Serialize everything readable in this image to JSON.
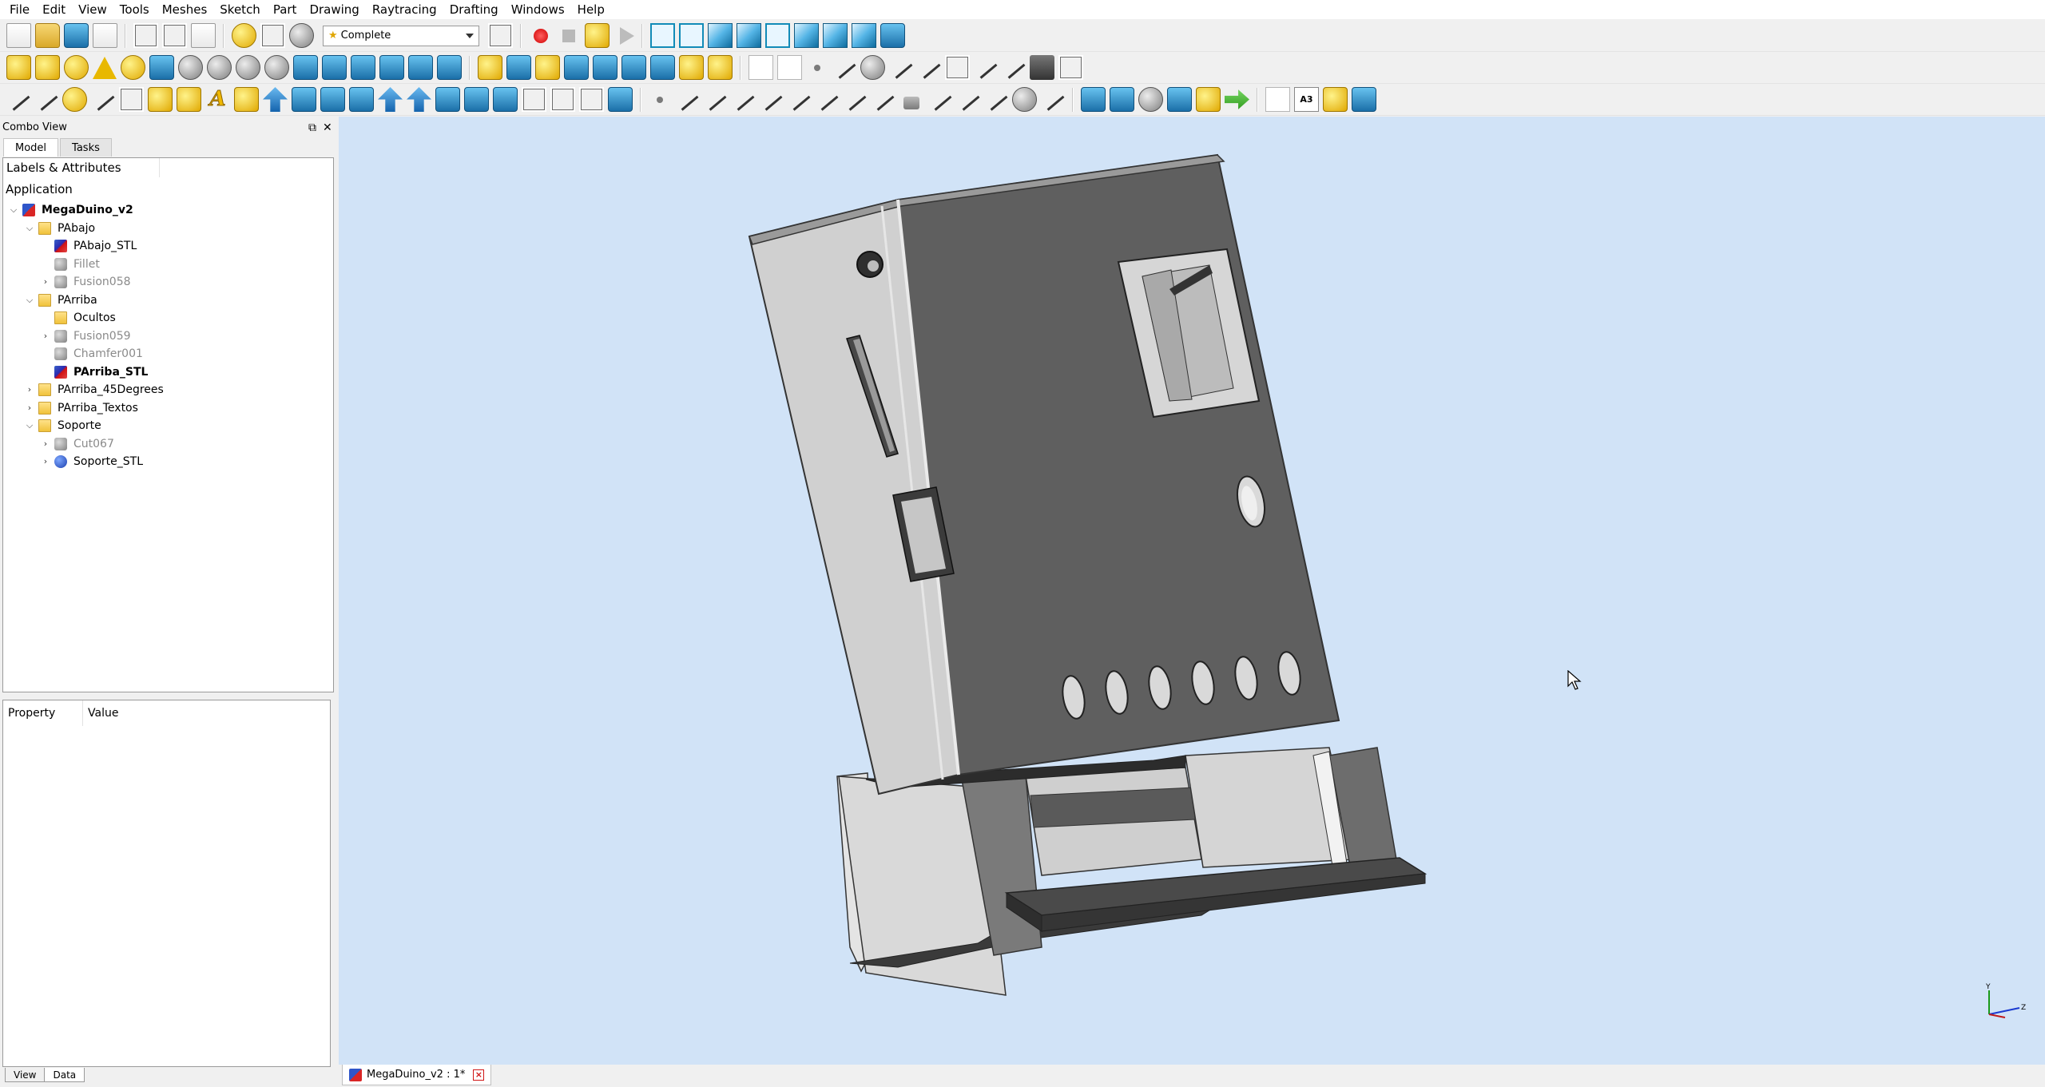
{
  "menu": [
    "File",
    "Edit",
    "View",
    "Tools",
    "Meshes",
    "Sketch",
    "Part",
    "Drawing",
    "Raytracing",
    "Drafting",
    "Windows",
    "Help"
  ],
  "workbench": {
    "selected": "Complete"
  },
  "combo_view": {
    "title": "Combo View",
    "tabs": [
      "Model",
      "Tasks"
    ],
    "tree_header": "Labels & Attributes",
    "application_label": "Application",
    "tree": [
      {
        "label": "MegaDuino_v2",
        "depth": 0,
        "expanded": true,
        "icon": "document-icon",
        "style": "bold"
      },
      {
        "label": "PAbajo",
        "depth": 1,
        "expanded": true,
        "icon": "folder-icon",
        "style": "normal"
      },
      {
        "label": "PAbajo_STL",
        "depth": 2,
        "expanded": null,
        "icon": "part-red-icon",
        "style": "normal"
      },
      {
        "label": "Fillet",
        "depth": 2,
        "expanded": null,
        "icon": "fillet-icon",
        "style": "gray"
      },
      {
        "label": "Fusion058",
        "depth": 2,
        "expanded": false,
        "icon": "fusion-icon",
        "style": "gray"
      },
      {
        "label": "PArriba",
        "depth": 1,
        "expanded": true,
        "icon": "folder-icon",
        "style": "normal"
      },
      {
        "label": "Ocultos",
        "depth": 2,
        "expanded": null,
        "icon": "folder-icon",
        "style": "normal"
      },
      {
        "label": "Fusion059",
        "depth": 2,
        "expanded": false,
        "icon": "fusion-icon",
        "style": "gray"
      },
      {
        "label": "Chamfer001",
        "depth": 2,
        "expanded": null,
        "icon": "chamfer-icon",
        "style": "gray"
      },
      {
        "label": "PArriba_STL",
        "depth": 2,
        "expanded": null,
        "icon": "part-red-icon",
        "style": "bold"
      },
      {
        "label": "PArriba_45Degrees",
        "depth": 1,
        "expanded": false,
        "icon": "folder-icon",
        "style": "normal"
      },
      {
        "label": "PArriba_Textos",
        "depth": 1,
        "expanded": false,
        "icon": "folder-icon",
        "style": "normal"
      },
      {
        "label": "Soporte",
        "depth": 1,
        "expanded": true,
        "icon": "folder-icon",
        "style": "normal"
      },
      {
        "label": "Cut067",
        "depth": 2,
        "expanded": false,
        "icon": "cut-icon",
        "style": "gray"
      },
      {
        "label": "Soporte_STL",
        "depth": 2,
        "expanded": false,
        "icon": "solid-blue-icon",
        "style": "normal"
      }
    ],
    "property_columns": [
      "Property",
      "Value"
    ],
    "bottom_tabs": [
      "View",
      "Data"
    ]
  },
  "document_tab": {
    "label": "MegaDuino_v2 : 1*"
  },
  "axis": {
    "y_label": "Y",
    "z_label": "Z"
  },
  "colors": {
    "viewport_bg": "#d1e3f7",
    "model_light": "#d2d2d2",
    "model_dark": "#5e5e5e"
  }
}
